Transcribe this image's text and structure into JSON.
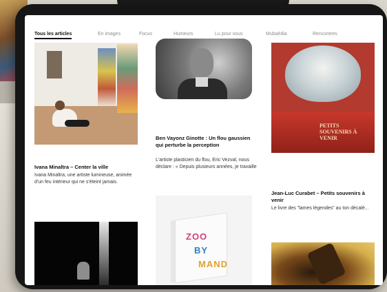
{
  "nav": {
    "tabs": [
      {
        "label": "Tous les articles",
        "active": true
      },
      {
        "label": "En images",
        "active": false
      },
      {
        "label": "Focus",
        "active": false
      },
      {
        "label": "Humeurs",
        "active": false
      },
      {
        "label": "Lu pour vous",
        "active": false
      },
      {
        "label": "Mubaédia",
        "active": false
      },
      {
        "label": "Rencontres",
        "active": false
      }
    ]
  },
  "articles": [
    {
      "title": "Ivana Minaltra – Center la ville",
      "excerpt": "Ivana Minaltra, une artiste lumineuse, animée d'un feu intérieur qui ne s'éteint jamais."
    },
    {
      "title": "Ben Vayonz Ginotte : Un flou gaussien qui perturbe la perception",
      "excerpt": "L'artiste plasticien du flou, Eric Vezval, nous déclare : « Depuis plusieurs années, je travaille"
    },
    {
      "title": "Jean-Luc Curabet – Petits souvenirs à venir",
      "excerpt": "Le livre des \"lames légendes\" au ton décalé..."
    }
  ],
  "covers": {
    "book_cover_text": "PETITS SOUVENIRS À VENIR",
    "zoo_book_text": "ZOO BY MAND"
  },
  "colors": {
    "accent": "#111111",
    "tab_inactive": "#8d8d8d",
    "book_red": "#b23a2e"
  }
}
